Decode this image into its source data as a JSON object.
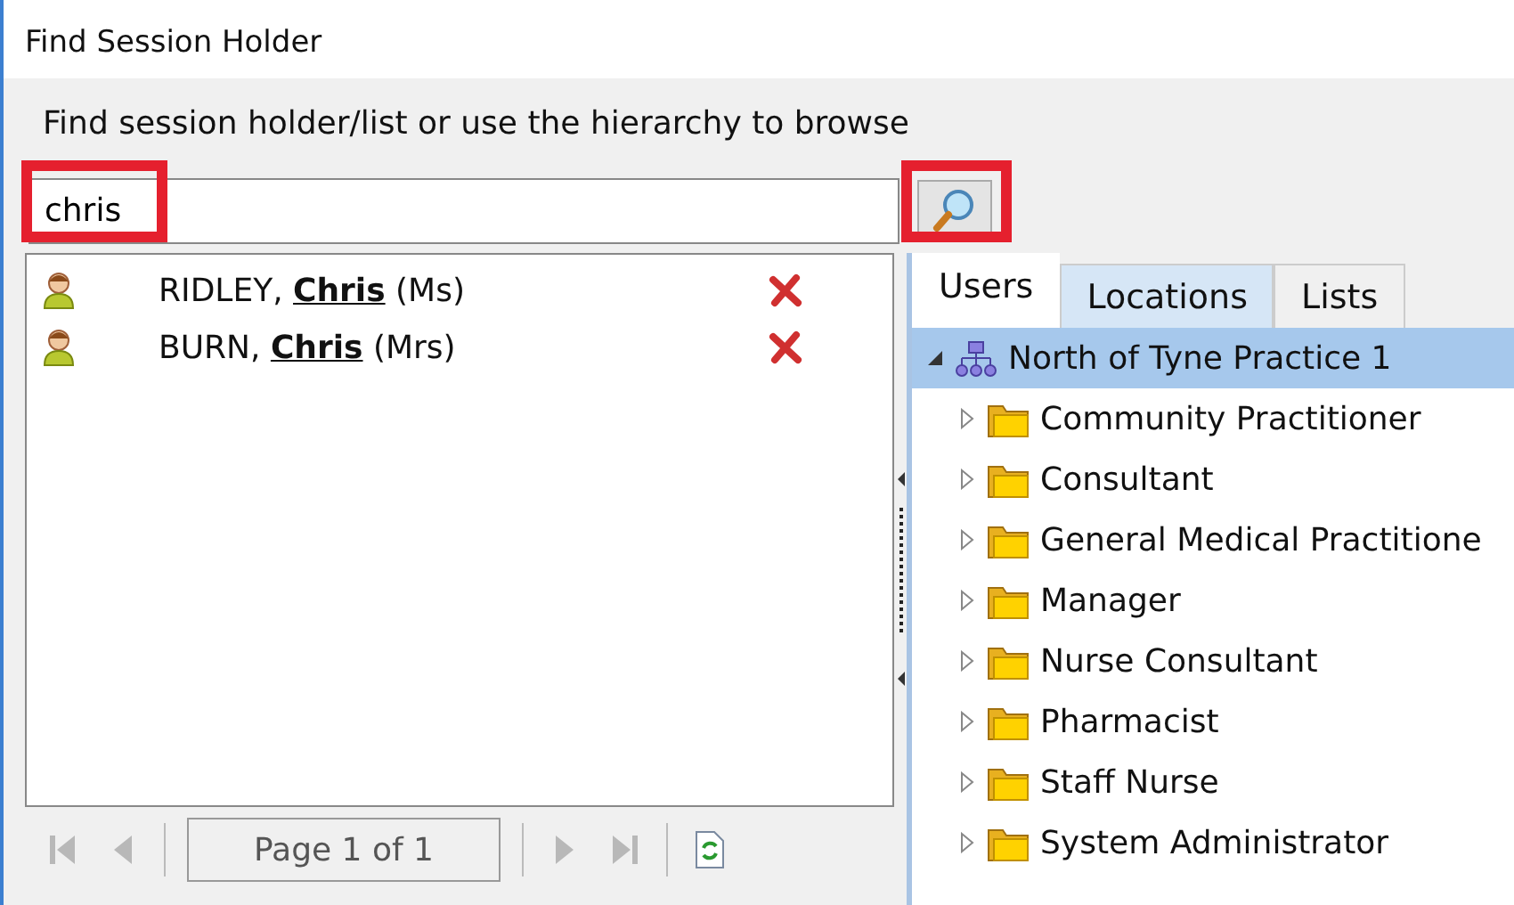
{
  "window": {
    "title": "Find Session Holder"
  },
  "instruction": "Find session holder/list or use the hierarchy to browse",
  "search": {
    "value": "chris",
    "highlighted": true
  },
  "search_button": {
    "highlighted": true
  },
  "results": [
    {
      "name": "RIDLEY, **Chris** (Ms)"
    },
    {
      "name": "BURN, **Chris** (Mrs)"
    }
  ],
  "pager": {
    "label": "Page 1 of 1",
    "first_disabled": true,
    "prev_disabled": true,
    "next_disabled": true,
    "last_disabled": true
  },
  "tabs": [
    {
      "label": "Users",
      "selected": true
    },
    {
      "label": "Locations",
      "selected": false
    },
    {
      "label": "Lists",
      "selected": false
    }
  ],
  "tree": [
    {
      "label": "North of Tyne Practice 1",
      "kind": "organisation",
      "selected": true,
      "expanded": true,
      "children": [
        {
          "label": "Community Practitioner",
          "kind": "folder",
          "selected": false,
          "expanded": false
        },
        {
          "label": "Consultant",
          "kind": "folder",
          "selected": false,
          "expanded": false
        },
        {
          "label": "General Medical Practitione",
          "kind": "folder",
          "selected": false,
          "expanded": false
        },
        {
          "label": "Manager",
          "kind": "folder",
          "selected": false,
          "expanded": false
        },
        {
          "label": "Nurse Consultant",
          "kind": "folder",
          "selected": false,
          "expanded": false
        },
        {
          "label": "Pharmacist",
          "kind": "folder",
          "selected": false,
          "expanded": false
        },
        {
          "label": "Staff Nurse",
          "kind": "folder",
          "selected": false,
          "expanded": false
        },
        {
          "label": "System Administrator",
          "kind": "folder",
          "selected": false,
          "expanded": false
        }
      ]
    }
  ]
}
